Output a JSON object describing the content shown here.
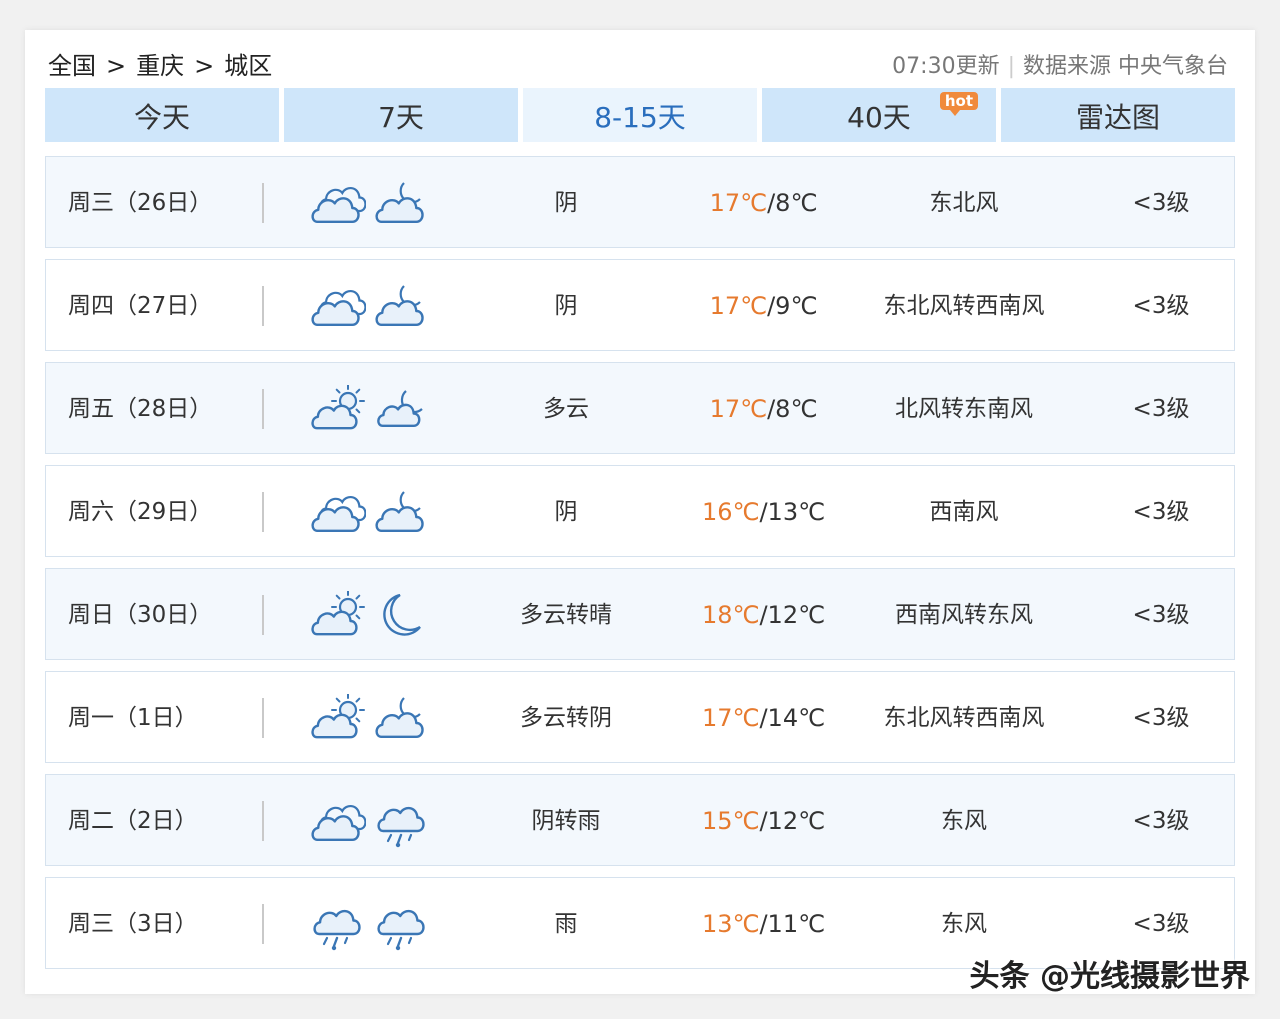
{
  "breadcrumb": {
    "items": [
      "全国",
      "重庆",
      "城区"
    ],
    "separator": ">"
  },
  "source": {
    "update": "07:30更新",
    "label": "数据来源 中央气象台"
  },
  "tabs": [
    {
      "label": "今天",
      "active": false
    },
    {
      "label": "7天",
      "active": false
    },
    {
      "label": "8-15天",
      "active": true
    },
    {
      "label": "40天",
      "active": false,
      "badge": "hot"
    },
    {
      "label": "雷达图",
      "active": false
    }
  ],
  "forecast": [
    {
      "day": "周三（26日）",
      "icons": [
        "cloud-icon",
        "cloud-moon-icon"
      ],
      "condition": "阴",
      "high": "17℃",
      "low": "8℃",
      "wind": "东北风",
      "level": "<3级"
    },
    {
      "day": "周四（27日）",
      "icons": [
        "cloud-icon",
        "cloud-moon-icon"
      ],
      "condition": "阴",
      "high": "17℃",
      "low": "9℃",
      "wind": "东北风转西南风",
      "level": "<3级"
    },
    {
      "day": "周五（28日）",
      "icons": [
        "partly-cloudy-day-icon",
        "partly-cloudy-night-icon"
      ],
      "condition": "多云",
      "high": "17℃",
      "low": "8℃",
      "wind": "北风转东南风",
      "level": "<3级"
    },
    {
      "day": "周六（29日）",
      "icons": [
        "cloud-icon",
        "cloud-moon-icon"
      ],
      "condition": "阴",
      "high": "16℃",
      "low": "13℃",
      "wind": "西南风",
      "level": "<3级"
    },
    {
      "day": "周日（30日）",
      "icons": [
        "partly-cloudy-day-icon",
        "moon-icon"
      ],
      "condition": "多云转晴",
      "high": "18℃",
      "low": "12℃",
      "wind": "西南风转东风",
      "level": "<3级"
    },
    {
      "day": "周一（1日）",
      "icons": [
        "partly-cloudy-day-icon",
        "cloud-moon-icon"
      ],
      "condition": "多云转阴",
      "high": "17℃",
      "low": "14℃",
      "wind": "东北风转西南风",
      "level": "<3级"
    },
    {
      "day": "周二（2日）",
      "icons": [
        "cloud-icon",
        "rain-icon"
      ],
      "condition": "阴转雨",
      "high": "15℃",
      "low": "12℃",
      "wind": "东风",
      "level": "<3级"
    },
    {
      "day": "周三（3日）",
      "icons": [
        "rain-icon",
        "rain-icon"
      ],
      "condition": "雨",
      "high": "13℃",
      "low": "11℃",
      "wind": "东风",
      "level": "<3级"
    }
  ],
  "watermark": "头条 @光线摄影世界",
  "colors": {
    "tab_bg": "#cfe6fa",
    "tab_active_bg": "#eaf4fd",
    "tab_active_text": "#2a6ebd",
    "high_temp": "#e67a2e",
    "icon_stroke": "#3a76b5",
    "hot_badge": "#f08a3c"
  }
}
